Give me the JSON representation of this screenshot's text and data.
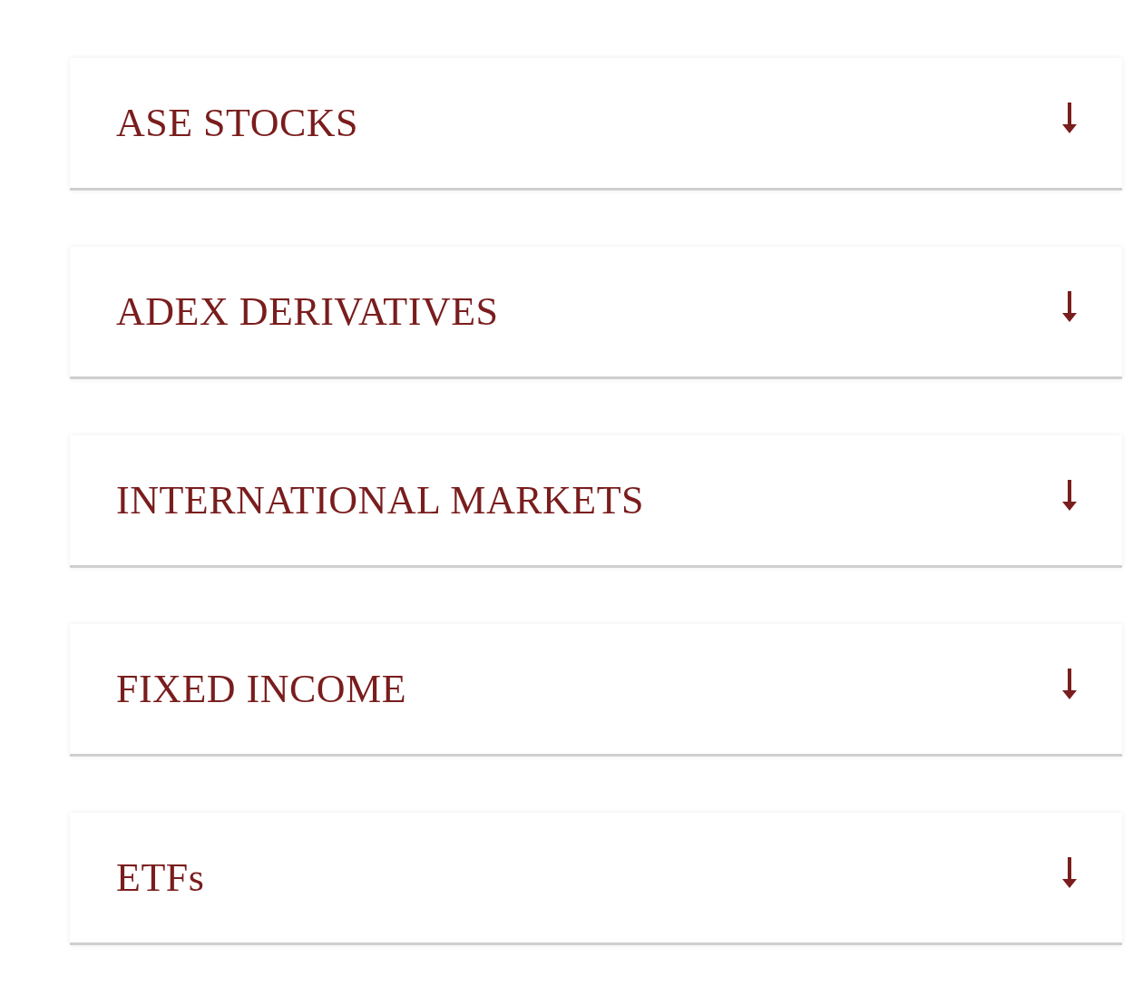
{
  "accordion": [
    {
      "title": "ASE STOCKS",
      "expanded": false
    },
    {
      "title": "ADEX DERIVATIVES",
      "expanded": false
    },
    {
      "title": "INTERNATIONAL MARKETS",
      "expanded": false
    },
    {
      "title": "FIXED INCOME",
      "expanded": false
    },
    {
      "title": "ETFs",
      "expanded": false
    }
  ]
}
